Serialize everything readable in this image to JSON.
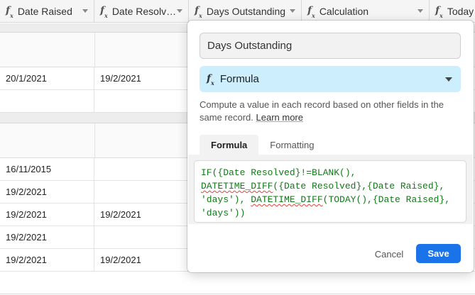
{
  "columns": [
    {
      "label": "Date Raised"
    },
    {
      "label": "Date Resolv…"
    },
    {
      "label": "Days Outstanding"
    },
    {
      "label": "Calculation"
    },
    {
      "label": "Today"
    }
  ],
  "rows": [
    {
      "date_raised": "20/1/2021",
      "date_resolved": "19/2/2021"
    },
    {
      "date_raised": "16/11/2015",
      "date_resolved": ""
    },
    {
      "date_raised": "19/2/2021",
      "date_resolved": ""
    },
    {
      "date_raised": "19/2/2021",
      "date_resolved": "19/2/2021"
    },
    {
      "date_raised": "19/2/2021",
      "date_resolved": ""
    },
    {
      "date_raised": "19/2/2021",
      "date_resolved": "19/2/2021"
    }
  ],
  "popup": {
    "field_name": "Days Outstanding",
    "field_type": "Formula",
    "field_type_icon": "formula-fx-icon",
    "description": "Compute a value in each record based on other fields in the same record.",
    "learn_more": "Learn more",
    "tabs": [
      "Formula",
      "Formatting"
    ],
    "active_tab": "Formula",
    "formula": {
      "line1": "IF({Date Resolved}!=BLANK(),",
      "line2_fn": "DATETIME_DIFF",
      "line2_rest": "({Date Resolved},{Date Raised},",
      "line3_pre": "'days'), ",
      "line3_fn": "DATETIME_DIFF",
      "line3_rest": "(TODAY(),{Date Raised},",
      "line4": "'days'))"
    },
    "cancel_label": "Cancel",
    "save_label": "Save"
  },
  "colors": {
    "accent": "#1a73e8",
    "formula_text": "#117a17",
    "type_select_bg": "#cdeefd"
  }
}
